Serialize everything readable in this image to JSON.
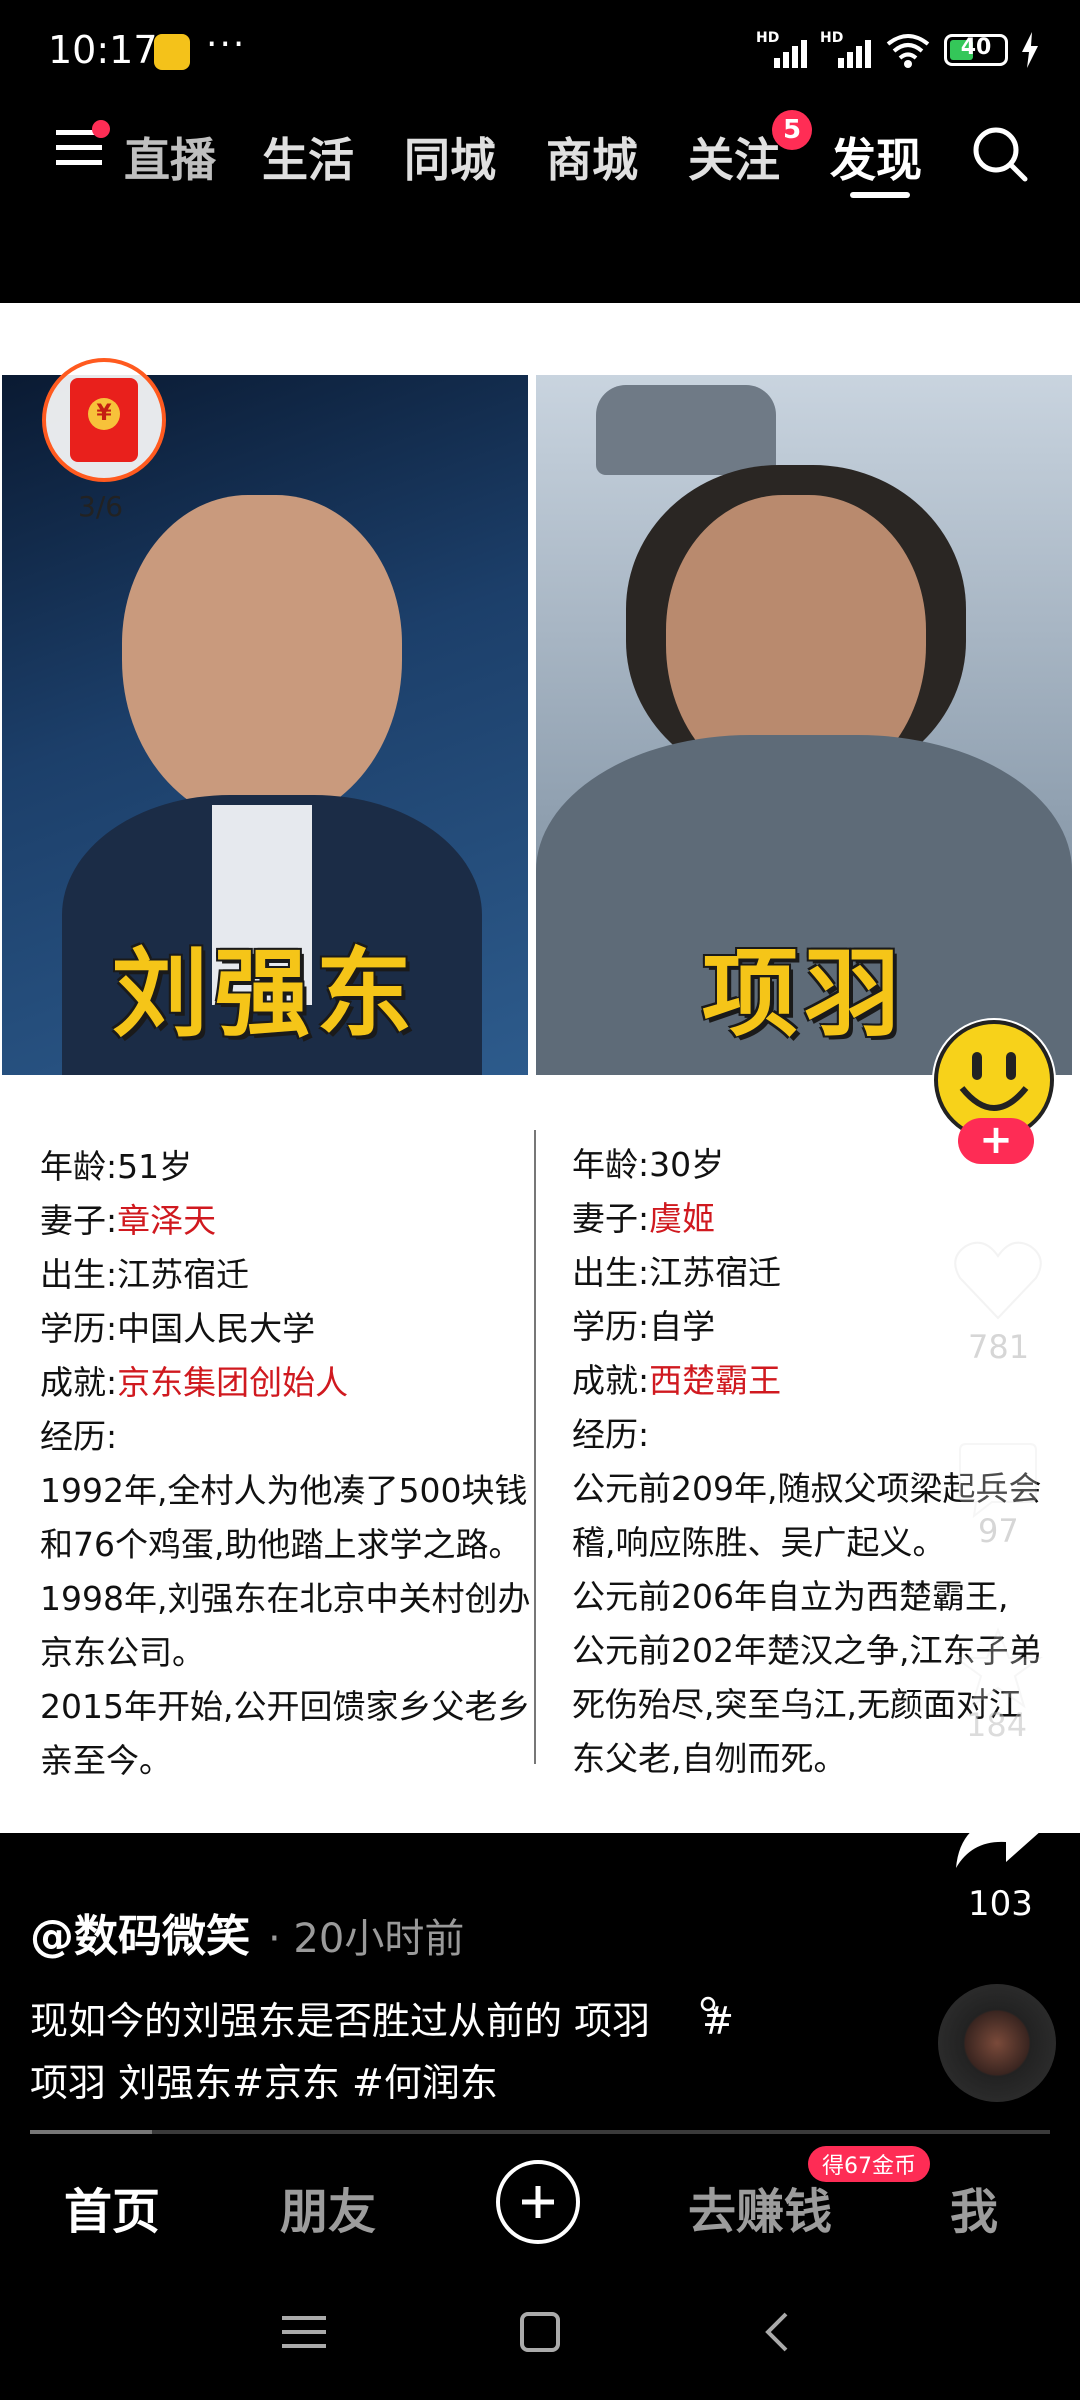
{
  "status_bar": {
    "time": "10:17",
    "more": "···",
    "signal_1_label": "HD",
    "signal_2_label": "HD",
    "battery": "40"
  },
  "top_nav": {
    "tabs": [
      {
        "label": "直播"
      },
      {
        "label": "生活"
      },
      {
        "label": "同城"
      },
      {
        "label": "商城"
      },
      {
        "label": "关注"
      },
      {
        "label": "发现"
      }
    ],
    "follow_badge": "5",
    "active_tab": "发现"
  },
  "red_packet": {
    "coin": "¥",
    "count": "3/6"
  },
  "post_images": {
    "left_name": "刘强东",
    "right_name": "项羽"
  },
  "left_column": {
    "age": "年龄:51岁",
    "wife_label": "妻子:",
    "wife_value": "章泽天",
    "birth": "出生:江苏宿迁",
    "education": "学历:中国人民大学",
    "achievement_label": "成就:",
    "achievement_value": "京东集团创始人",
    "experience_label": "经历:",
    "experience_lines": [
      "1992年,全村人为他凑了500块钱",
      "和76个鸡蛋,助他踏上求学之路。",
      "1998年,刘强东在北京中关村创办",
      "京东公司。",
      "2015年开始,公开回馈家乡父老乡",
      "亲至今。"
    ]
  },
  "right_column": {
    "age": "年龄:30岁",
    "wife_label": "妻子:",
    "wife_value": "虞姬",
    "birth": "出生:江苏宿迁",
    "education": "学历:自学",
    "achievement_label": "成就:",
    "achievement_value": "西楚霸王",
    "experience_label": "经历:",
    "experience_lines": [
      "公元前209年,随叔父项梁起兵会",
      "稽,响应陈胜、吴广起义。",
      "公元前206年自立为西楚霸王,",
      "公元前202年楚汉之争,江东子弟",
      "死伤殆尽,突至乌江,无颜面对江",
      "东父老,自刎而死。"
    ]
  },
  "actions": {
    "like_count": "781",
    "comment_count": "97",
    "favorite_count": "184",
    "share_count": "103"
  },
  "caption": {
    "author": "@数码微笑",
    "time": "· 20小时前",
    "line1": "现如今的刘强东是否胜过从前的 项羽",
    "line1_tag": " #",
    "line2": "项羽 刘强东#京东 #何润东"
  },
  "progress": {
    "value": 0.12
  },
  "bottom_nav": {
    "home": "首页",
    "friends": "朋友",
    "earn": "去赚钱",
    "earn_badge": "得67金币",
    "me": "我"
  },
  "colors": {
    "accent_red": "#fe2c55",
    "text_red": "#d0191f",
    "name_gold": "#f5c518"
  }
}
